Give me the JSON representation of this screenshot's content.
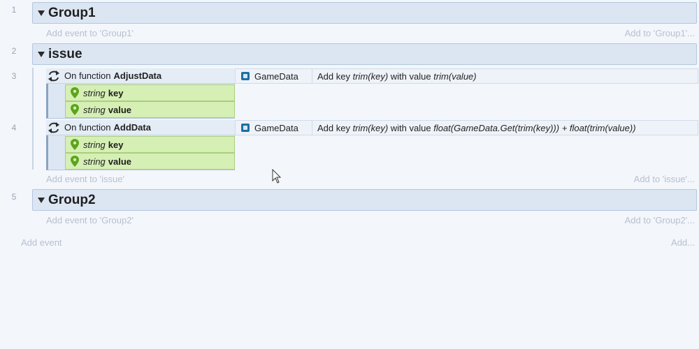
{
  "rows": [
    "1",
    "2",
    "3",
    "4",
    "5"
  ],
  "groups": [
    {
      "title": "Group1",
      "add_event": "Add event to 'Group1'",
      "add_to": "Add to 'Group1'..."
    },
    {
      "title": "issue",
      "add_event": "Add event to 'issue'",
      "add_to": "Add to 'issue'..."
    },
    {
      "title": "Group2",
      "add_event": "Add event to 'Group2'",
      "add_to": "Add to 'Group2'..."
    }
  ],
  "events": [
    {
      "condition_prefix": "On function",
      "function_name": "AdjustData",
      "params": [
        {
          "type": "string",
          "name": "key"
        },
        {
          "type": "string",
          "name": "value"
        }
      ],
      "action": {
        "object": "GameData",
        "prefix": "Add key",
        "key_expr": "trim(key)",
        "middle": "with value",
        "value_expr": "trim(value)"
      }
    },
    {
      "condition_prefix": "On function",
      "function_name": "AddData",
      "params": [
        {
          "type": "string",
          "name": "key"
        },
        {
          "type": "string",
          "name": "value"
        }
      ],
      "action": {
        "object": "GameData",
        "prefix": "Add key",
        "key_expr": "trim(key)",
        "middle": "with value",
        "value_expr": "float(GameData.Get(trim(key))) + float(trim(value))"
      }
    }
  ],
  "footer": {
    "add_event": "Add event",
    "add": "Add..."
  },
  "colors": {
    "group_header": "#dce6f3",
    "param_bg": "#d6efb5",
    "object_icon": "#1e6fa3"
  },
  "icons": {
    "loop": "loop-arrows-icon",
    "param": "map-pin-icon",
    "object": "dictionary-icon",
    "collapse": "triangle-down-icon"
  }
}
